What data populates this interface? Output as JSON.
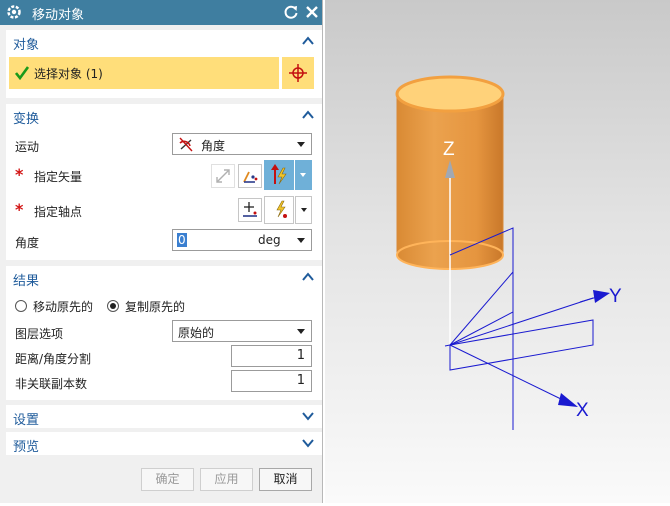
{
  "dialog": {
    "title": "移动对象",
    "sections": {
      "object": {
        "title": "对象",
        "select_label": "选择对象 (1)"
      },
      "transform": {
        "title": "变换",
        "motion_label": "运动",
        "motion_value": "角度",
        "vector_label": "指定矢量",
        "pivot_label": "指定轴点",
        "angle_label": "角度",
        "angle_value": "0",
        "angle_unit": "deg"
      },
      "result": {
        "title": "结果",
        "option_move": "移动原先的",
        "option_copy": "复制原先的",
        "selected_option": "复制原先的",
        "layer_label": "图层选项",
        "layer_value": "原始的",
        "split_label": "距离/角度分割",
        "split_value": "1",
        "copies_label": "非关联副本数",
        "copies_value": "1"
      },
      "settings": {
        "title": "设置"
      },
      "preview": {
        "title": "预览"
      }
    },
    "buttons": {
      "ok": "确定",
      "apply": "应用",
      "cancel": "取消"
    }
  },
  "viewport": {
    "axes": {
      "z": "Z",
      "y": "Y",
      "x": "X"
    }
  },
  "colors": {
    "titlebar": "#3f7ea0",
    "section_title": "#1f5b9b",
    "selection_highlight": "#ffde7a",
    "cylinder": "#e89a40",
    "axis_blue": "#0000c8"
  }
}
